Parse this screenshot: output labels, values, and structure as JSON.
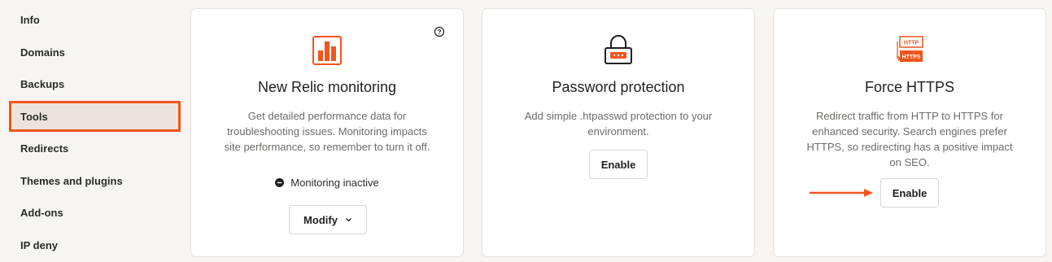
{
  "sidebar": {
    "items": [
      {
        "label": "Info"
      },
      {
        "label": "Domains"
      },
      {
        "label": "Backups"
      },
      {
        "label": "Tools"
      },
      {
        "label": "Redirects"
      },
      {
        "label": "Themes and plugins"
      },
      {
        "label": "Add-ons"
      },
      {
        "label": "IP deny"
      }
    ],
    "active": "Tools"
  },
  "cards": {
    "new_relic": {
      "title": "New Relic monitoring",
      "description_lines": [
        "Get detailed performance data for",
        "troubleshooting issues. Monitoring impacts",
        "site performance, so remember to turn it off."
      ],
      "status": "Monitoring inactive",
      "button": "Modify",
      "icon": "bar-chart-icon"
    },
    "password": {
      "title": "Password protection",
      "description_lines": [
        "Add simple .htpasswd protection to your",
        "environment."
      ],
      "button": "Enable",
      "icon": "lock-icon"
    },
    "https": {
      "title": "Force HTTPS",
      "description_lines": [
        "Redirect traffic from HTTP to HTTPS for",
        "enhanced security. Search engines prefer",
        "HTTPS, so redirecting has a positive impact",
        "on SEO."
      ],
      "button": "Enable",
      "icon": "http-to-https-icon",
      "icon_labels": {
        "top": "HTTP",
        "bottom": "HTTPS"
      }
    }
  },
  "colors": {
    "accent": "#f2551d",
    "active_bg": "#ede3de",
    "page_bg": "#f7f4f2"
  }
}
